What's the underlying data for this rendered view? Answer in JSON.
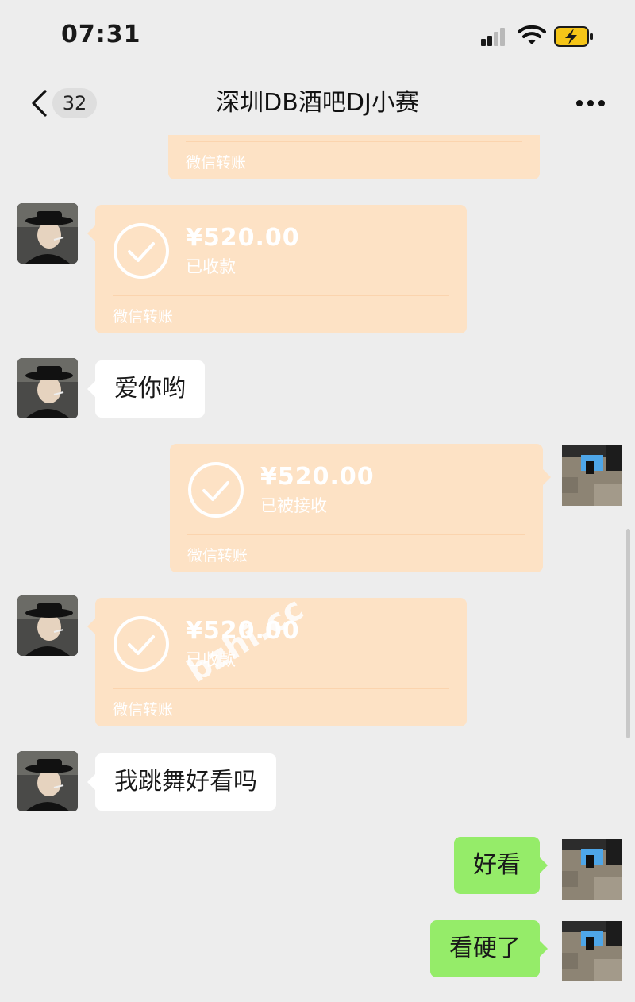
{
  "status_bar": {
    "time": "07:31"
  },
  "nav_bar": {
    "unread_count": "32",
    "title": "深圳DB酒吧DJ小赛"
  },
  "messages": [
    {
      "type": "transfer",
      "side": "right",
      "amount": "",
      "status": "",
      "footer": "微信转账",
      "partial": true
    },
    {
      "type": "transfer",
      "side": "left",
      "amount": "¥520.00",
      "status": "已收款",
      "footer": "微信转账"
    },
    {
      "type": "text",
      "side": "left",
      "text": "爱你哟"
    },
    {
      "type": "transfer",
      "side": "right",
      "amount": "¥520.00",
      "status": "已被接收",
      "footer": "微信转账"
    },
    {
      "type": "transfer",
      "side": "left",
      "amount": "¥520.00",
      "status": "已收款",
      "footer": "微信转账"
    },
    {
      "type": "text",
      "side": "left",
      "text": "我跳舞好看吗"
    },
    {
      "type": "text",
      "side": "right",
      "text": "好看"
    },
    {
      "type": "text",
      "side": "right",
      "text": "看硬了"
    }
  ],
  "watermark": "bzhi.cc",
  "colors": {
    "background": "#ededed",
    "transfer_bubble": "#fde2c5",
    "sent_bubble": "#95ec69",
    "received_bubble": "#ffffff"
  },
  "icons": {
    "back": "chevron-left-icon",
    "more": "ellipsis-icon",
    "transfer_status": "check-circle-icon"
  }
}
